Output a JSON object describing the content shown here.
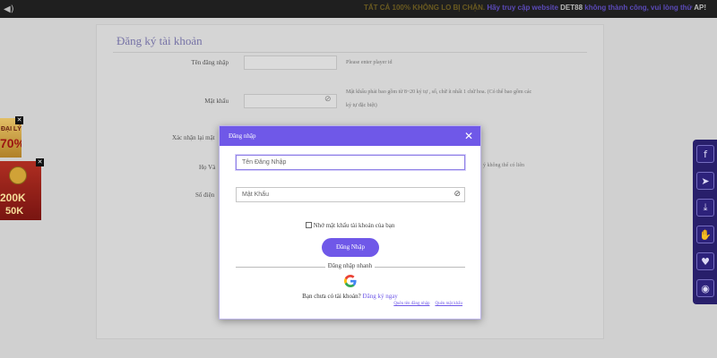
{
  "topbar": {
    "marquee_gold": "TẤT CẢ 100% KHÔNG LO BỊ CHẶN.",
    "marquee_mid": "Hãy truy cập website",
    "marquee_brand": "DET88",
    "marquee_end": "không thành công, vui lòng thử",
    "marquee_last": "AP!"
  },
  "register": {
    "title": "Đăng ký tài khoản",
    "username_label": "Tên đăng nhập",
    "username_hint": "Please enter player id",
    "password_label": "Mật khẩu",
    "password_hint_1": "Mật khẩu phải bao gồm từ 8~20 ký tự , số, chữ ít nhất 1 chữ hoa. (Có thể bao gồm các",
    "password_hint_2": "ký tự đặc biệt)",
    "confirm_label": "Xác nhận lại mật",
    "fullname_label": "Họ Và",
    "fullname_hint": "ý không thể có liên",
    "phone_label": "Số điện"
  },
  "promos": {
    "promo1_line1": "ĐẠI LÝ",
    "promo1_line2": "70%",
    "promo2_line1": "200K",
    "promo2_line2": "50K"
  },
  "social": [
    "facebook-icon",
    "telegram-icon",
    "download-icon",
    "gift-icon",
    "heart-hand-icon",
    "eye-icon"
  ],
  "modal": {
    "title": "Đăng nhập",
    "username_placeholder": "Tên Đăng Nhập",
    "password_placeholder": "Mật Khẩu",
    "remember_label": "Nhớ mật khẩu tài khoản của bạn",
    "login_button": "Đăng Nhập",
    "quick_login": "Đăng nhập nhanh",
    "no_account": "Bạn chưa có tài khoản?",
    "signup_link": "Đăng ký ngay",
    "forgot_username": "Quên tên đăng nhập",
    "forgot_password": "Quên mật khẩu"
  },
  "colors": {
    "accent": "#6f58e8",
    "social_bg": "#2a2170"
  }
}
